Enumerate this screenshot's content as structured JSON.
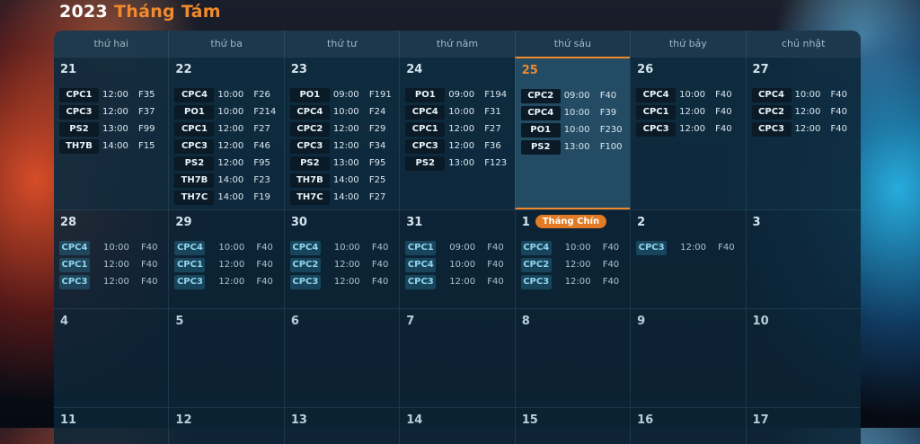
{
  "header": {
    "year": "2023",
    "month": "Tháng Tám"
  },
  "weekdays": [
    "thứ hai",
    "thứ ba",
    "thứ tư",
    "thứ năm",
    "thứ sáu",
    "thứ bảy",
    "chủ nhật"
  ],
  "weeks": [
    {
      "days": [
        {
          "num": "21",
          "events": [
            {
              "code": "CPC1",
              "time": "12:00",
              "room": "F35"
            },
            {
              "code": "CPC3",
              "time": "12:00",
              "room": "F37"
            },
            {
              "code": "PS2",
              "time": "13:00",
              "room": "F99"
            },
            {
              "code": "TH7B",
              "time": "14:00",
              "room": "F15"
            }
          ]
        },
        {
          "num": "22",
          "events": [
            {
              "code": "CPC4",
              "time": "10:00",
              "room": "F26"
            },
            {
              "code": "PO1",
              "time": "10:00",
              "room": "F214"
            },
            {
              "code": "CPC1",
              "time": "12:00",
              "room": "F27"
            },
            {
              "code": "CPC3",
              "time": "12:00",
              "room": "F46"
            },
            {
              "code": "PS2",
              "time": "12:00",
              "room": "F95"
            },
            {
              "code": "TH7B",
              "time": "14:00",
              "room": "F23"
            },
            {
              "code": "TH7C",
              "time": "14:00",
              "room": "F19"
            }
          ]
        },
        {
          "num": "23",
          "events": [
            {
              "code": "PO1",
              "time": "09:00",
              "room": "F191"
            },
            {
              "code": "CPC4",
              "time": "10:00",
              "room": "F24"
            },
            {
              "code": "CPC2",
              "time": "12:00",
              "room": "F29"
            },
            {
              "code": "CPC3",
              "time": "12:00",
              "room": "F34"
            },
            {
              "code": "PS2",
              "time": "13:00",
              "room": "F95"
            },
            {
              "code": "TH7B",
              "time": "14:00",
              "room": "F25"
            },
            {
              "code": "TH7C",
              "time": "14:00",
              "room": "F27"
            }
          ]
        },
        {
          "num": "24",
          "events": [
            {
              "code": "PO1",
              "time": "09:00",
              "room": "F194"
            },
            {
              "code": "CPC4",
              "time": "10:00",
              "room": "F31"
            },
            {
              "code": "CPC1",
              "time": "12:00",
              "room": "F27"
            },
            {
              "code": "CPC3",
              "time": "12:00",
              "room": "F36"
            },
            {
              "code": "PS2",
              "time": "13:00",
              "room": "F123"
            }
          ]
        },
        {
          "num": "25",
          "today": true,
          "events": [
            {
              "code": "CPC2",
              "time": "09:00",
              "room": "F40"
            },
            {
              "code": "CPC4",
              "time": "10:00",
              "room": "F39"
            },
            {
              "code": "PO1",
              "time": "10:00",
              "room": "F230"
            },
            {
              "code": "PS2",
              "time": "13:00",
              "room": "F100"
            }
          ]
        },
        {
          "num": "26",
          "events": [
            {
              "code": "CPC4",
              "time": "10:00",
              "room": "F40"
            },
            {
              "code": "CPC1",
              "time": "12:00",
              "room": "F40"
            },
            {
              "code": "CPC3",
              "time": "12:00",
              "room": "F40"
            }
          ]
        },
        {
          "num": "27",
          "events": [
            {
              "code": "CPC4",
              "time": "10:00",
              "room": "F40"
            },
            {
              "code": "CPC2",
              "time": "12:00",
              "room": "F40"
            },
            {
              "code": "CPC3",
              "time": "12:00",
              "room": "F40"
            }
          ]
        }
      ]
    },
    {
      "days": [
        {
          "num": "28",
          "events": [
            {
              "code": "CPC4",
              "time": "10:00",
              "room": "F40"
            },
            {
              "code": "CPC1",
              "time": "12:00",
              "room": "F40"
            },
            {
              "code": "CPC3",
              "time": "12:00",
              "room": "F40"
            }
          ]
        },
        {
          "num": "29",
          "events": [
            {
              "code": "CPC4",
              "time": "10:00",
              "room": "F40"
            },
            {
              "code": "CPC1",
              "time": "12:00",
              "room": "F40"
            },
            {
              "code": "CPC3",
              "time": "12:00",
              "room": "F40"
            }
          ]
        },
        {
          "num": "30",
          "events": [
            {
              "code": "CPC4",
              "time": "10:00",
              "room": "F40"
            },
            {
              "code": "CPC2",
              "time": "12:00",
              "room": "F40"
            },
            {
              "code": "CPC3",
              "time": "12:00",
              "room": "F40"
            }
          ]
        },
        {
          "num": "31",
          "events": [
            {
              "code": "CPC1",
              "time": "09:00",
              "room": "F40"
            },
            {
              "code": "CPC4",
              "time": "10:00",
              "room": "F40"
            },
            {
              "code": "CPC3",
              "time": "12:00",
              "room": "F40"
            }
          ]
        },
        {
          "num": "1",
          "badge": "Tháng Chín",
          "events": [
            {
              "code": "CPC4",
              "time": "10:00",
              "room": "F40"
            },
            {
              "code": "CPC2",
              "time": "12:00",
              "room": "F40"
            },
            {
              "code": "CPC3",
              "time": "12:00",
              "room": "F40"
            }
          ]
        },
        {
          "num": "2",
          "events": [
            {
              "code": "CPC3",
              "time": "12:00",
              "room": "F40"
            }
          ]
        },
        {
          "num": "3",
          "events": []
        }
      ]
    },
    {
      "days": [
        {
          "num": "4",
          "events": []
        },
        {
          "num": "5",
          "events": []
        },
        {
          "num": "6",
          "events": []
        },
        {
          "num": "7",
          "events": []
        },
        {
          "num": "8",
          "events": []
        },
        {
          "num": "9",
          "events": []
        },
        {
          "num": "10",
          "events": []
        }
      ]
    },
    {
      "days": [
        {
          "num": "11",
          "events": []
        },
        {
          "num": "12",
          "events": []
        },
        {
          "num": "13",
          "events": []
        },
        {
          "num": "14",
          "events": []
        },
        {
          "num": "15",
          "events": []
        },
        {
          "num": "16",
          "events": []
        },
        {
          "num": "17",
          "events": []
        }
      ]
    }
  ]
}
